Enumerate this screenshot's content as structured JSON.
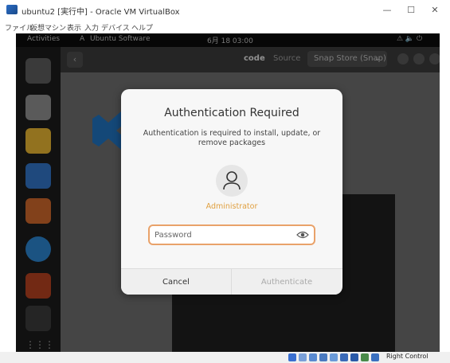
{
  "host": {
    "window_title": "ubuntu2 [実行中] - Oracle VM VirtualBox",
    "controls": {
      "minimize": "—",
      "maximize": "☐",
      "close": "✕"
    },
    "menu": [
      "ファイル",
      "仮想マシン",
      "表示",
      "入力",
      "デバイス",
      "ヘルプ"
    ],
    "host_key": "Right Control"
  },
  "gnome": {
    "activities": "Activities",
    "app_name": "Ubuntu Software",
    "clock": "6月 18 03:00",
    "tray": "⚠ 🔈 ⏻"
  },
  "software": {
    "back": "‹",
    "query": "code",
    "source_label": "Source",
    "source_value": "Snap Store (Snap)",
    "source_arrow": "⌄"
  },
  "dialog": {
    "title": "Authentication Required",
    "description": "Authentication is required to install, update, or remove packages",
    "user": "Administrator",
    "password_placeholder": "Password",
    "cancel": "Cancel",
    "authenticate": "Authenticate"
  },
  "colors": {
    "accent_orange": "#e9a26a",
    "user_name": "#e0a040",
    "dock_bg": "#1b1b1b"
  }
}
